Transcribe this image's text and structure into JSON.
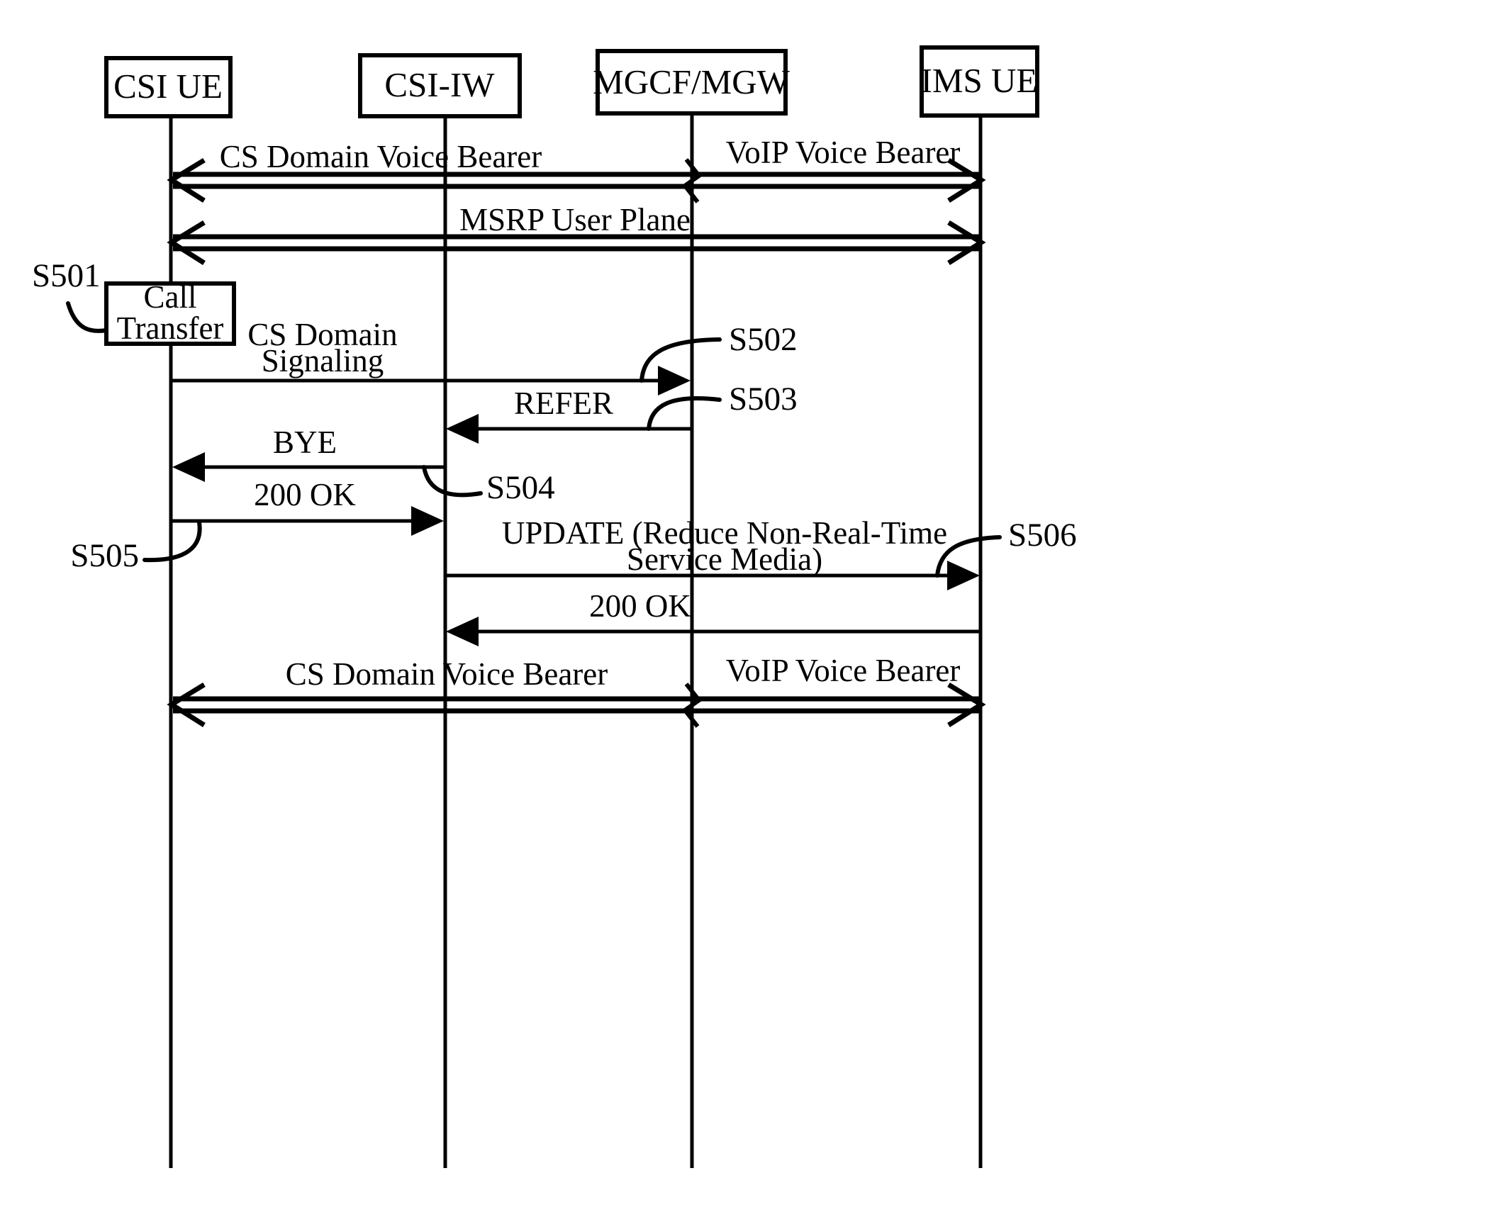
{
  "diagram": {
    "title": "CSI Call Transfer Sequence Diagram",
    "type": "sequence-diagram",
    "line_color": "#000000",
    "background_color": "#ffffff"
  },
  "lifelines": [
    {
      "id": "csi_ue",
      "label": "CSI UE"
    },
    {
      "id": "csi_iw",
      "label": "CSI-IW"
    },
    {
      "id": "mgcf_mgw",
      "label": "MGCF/MGW"
    },
    {
      "id": "ims_ue",
      "label": "IMS UE"
    }
  ],
  "notes": [
    {
      "id": "call_transfer",
      "line1": "Call",
      "line2": "Transfer"
    }
  ],
  "messages": [
    {
      "id": "m1",
      "label": "CS Domain Voice Bearer",
      "from": "csi_ue",
      "to": "mgcf_mgw",
      "style": "bearer-double",
      "direction": "both"
    },
    {
      "id": "m2",
      "label": "VoIP Voice Bearer",
      "from": "mgcf_mgw",
      "to": "ims_ue",
      "style": "bearer-double",
      "direction": "both"
    },
    {
      "id": "m3",
      "label": "MSRP User Plane",
      "from": "csi_ue",
      "to": "ims_ue",
      "style": "bearer-double",
      "direction": "both"
    },
    {
      "id": "m4",
      "label_line1": "CS Domain",
      "label_line2": "Signaling",
      "label": "CS Domain Signaling",
      "from": "csi_ue",
      "to": "mgcf_mgw",
      "style": "solid",
      "direction": "right"
    },
    {
      "id": "m5",
      "label": "REFER",
      "from": "mgcf_mgw",
      "to": "csi_iw",
      "style": "solid",
      "direction": "left"
    },
    {
      "id": "m6",
      "label": "BYE",
      "from": "csi_iw",
      "to": "csi_ue",
      "style": "solid",
      "direction": "left"
    },
    {
      "id": "m7",
      "label": "200 OK",
      "from": "csi_ue",
      "to": "csi_iw",
      "style": "solid",
      "direction": "right"
    },
    {
      "id": "m8",
      "label_line1": "UPDATE (Reduce Non-Real-Time",
      "label_line2": "Service Media)",
      "label": "UPDATE (Reduce Non-Real-Time Service Media)",
      "from": "csi_iw",
      "to": "ims_ue",
      "style": "solid",
      "direction": "right"
    },
    {
      "id": "m9",
      "label": "200 OK",
      "from": "ims_ue",
      "to": "csi_iw",
      "style": "solid",
      "direction": "left"
    },
    {
      "id": "m10",
      "label": "CS Domain Voice Bearer",
      "from": "csi_ue",
      "to": "mgcf_mgw",
      "style": "bearer-double",
      "direction": "both"
    },
    {
      "id": "m11",
      "label": "VoIP Voice Bearer",
      "from": "mgcf_mgw",
      "to": "ims_ue",
      "style": "bearer-double",
      "direction": "both"
    }
  ],
  "step_labels": [
    {
      "id": "s501",
      "label": "S501",
      "anchor": "call-transfer-note"
    },
    {
      "id": "s502",
      "label": "S502",
      "anchor": "cs-domain-signaling-arrow"
    },
    {
      "id": "s503",
      "label": "S503",
      "anchor": "refer-arrow"
    },
    {
      "id": "s504",
      "label": "S504",
      "anchor": "bye-arrow"
    },
    {
      "id": "s505",
      "label": "S505",
      "anchor": "200-ok-arrow"
    },
    {
      "id": "s506",
      "label": "S506",
      "anchor": "update-arrow"
    }
  ]
}
